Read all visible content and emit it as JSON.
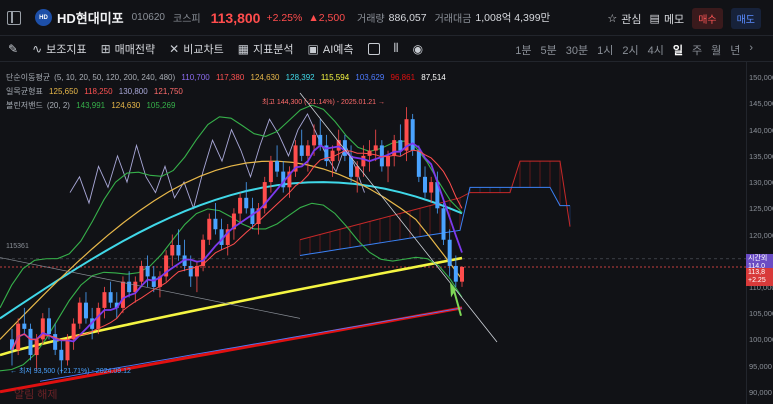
{
  "header": {
    "stock_name": "HD현대미포",
    "logo_text": "HD",
    "code": "010620",
    "market": "코스피",
    "price": "113,800",
    "change_pct": "+2.25%",
    "change_amt": "▲2,500",
    "volume_label": "거래량",
    "volume": "886,057",
    "amount_label": "거래대금",
    "amount": "1,008억 4,399만",
    "watchlist": "관심",
    "memo": "메모",
    "buy": "매수",
    "sell": "매도"
  },
  "toolbar": {
    "indicators": "보조지표",
    "strategy": "매매전략",
    "compare": "비교차트",
    "analysis": "지표분석",
    "ai": "AI예측",
    "periods": [
      "1분",
      "5분",
      "30분",
      "1시",
      "2시",
      "4시",
      "일",
      "주",
      "월",
      "년"
    ],
    "active_period": "일"
  },
  "legend": {
    "ma": {
      "label": "단순이동평균",
      "params": "(5, 10, 20, 50, 120, 200, 240, 480)",
      "values": [
        "110,700",
        "117,380",
        "124,630",
        "128,392",
        "115,594",
        "103,629",
        "96,861",
        "87,514"
      ]
    },
    "ichimoku": {
      "label": "일목균형표",
      "values": [
        "125,650",
        "118,250",
        "130,800",
        "121,750"
      ]
    },
    "bollinger": {
      "label": "볼린저밴드",
      "params": "(20, 2)",
      "values": [
        "143,991",
        "124,630",
        "105,269"
      ]
    }
  },
  "colors": {
    "up": "#ff4d4d",
    "down": "#4aa3ff",
    "ma5": "#7c3aed",
    "ma10": "#ff4d4d",
    "ma20": "#e8b84a",
    "ma50": "#40d8e8",
    "ma120": "#4d7bff",
    "ma200": "#ff6b6b",
    "ma240": "#ff9800",
    "ma480": "#ffffff",
    "ma_yellow": "#f5f542",
    "ma_red": "#e01010",
    "bb": "#36b04a",
    "cloud_red": "#c62828",
    "cloud_blue": "#3b82f6",
    "lagging": "#a9a8d8"
  },
  "annotations": {
    "high": "최고 144,300 (-21.14%) - 2025.01.21 →",
    "low": "← 최저 93,500 (+21.71%) - 2024.09.12",
    "level": "115361",
    "watermark": "알림 해제"
  },
  "axis": {
    "ticks": [
      "150,000",
      "145,000",
      "140,000",
      "135,000",
      "130,000",
      "125,000",
      "120,000",
      "115,000",
      "110,000",
      "105,000",
      "100,000",
      "95,000",
      "90,000"
    ],
    "tag_purple_top": "시간외",
    "tag_purple_bot": "114,0",
    "tag_red_top": "113,8",
    "tag_red_bot": "+2.25"
  },
  "chart_data": {
    "type": "candlestick",
    "y_range": [
      89000,
      151000
    ],
    "candles": [
      [
        100,
        102,
        95,
        98
      ],
      [
        98,
        104,
        97,
        103
      ],
      [
        103,
        106,
        101,
        102
      ],
      [
        102,
        103,
        96,
        97
      ],
      [
        97,
        101,
        94,
        100
      ],
      [
        100,
        105,
        99,
        104
      ],
      [
        104,
        106,
        100,
        101
      ],
      [
        101,
        103,
        97,
        98
      ],
      [
        98,
        100,
        93.5,
        96
      ],
      [
        96,
        101,
        95,
        100
      ],
      [
        100,
        104,
        98,
        103
      ],
      [
        103,
        108,
        102,
        107
      ],
      [
        107,
        109,
        103,
        104
      ],
      [
        104,
        106,
        100,
        102
      ],
      [
        102,
        107,
        101,
        106
      ],
      [
        106,
        110,
        104,
        109
      ],
      [
        109,
        111,
        106,
        107
      ],
      [
        107,
        109,
        104,
        106
      ],
      [
        106,
        112,
        105,
        111
      ],
      [
        111,
        113,
        108,
        109
      ],
      [
        109,
        112,
        107,
        111
      ],
      [
        111,
        115,
        110,
        114
      ],
      [
        114,
        116,
        110,
        112
      ],
      [
        112,
        114,
        109,
        110
      ],
      [
        110,
        113,
        108,
        112
      ],
      [
        112,
        117,
        111,
        116
      ],
      [
        116,
        120,
        114,
        118
      ],
      [
        118,
        121,
        115,
        116
      ],
      [
        116,
        119,
        113,
        114
      ],
      [
        114,
        116,
        110,
        112
      ],
      [
        112,
        115,
        109,
        114
      ],
      [
        114,
        120,
        113,
        119
      ],
      [
        119,
        124,
        118,
        123
      ],
      [
        123,
        126,
        120,
        121
      ],
      [
        121,
        123,
        117,
        118
      ],
      [
        118,
        122,
        116,
        121
      ],
      [
        121,
        125,
        119,
        124
      ],
      [
        124,
        128,
        122,
        127
      ],
      [
        127,
        130,
        124,
        125
      ],
      [
        125,
        127,
        121,
        122
      ],
      [
        122,
        126,
        120,
        125
      ],
      [
        125,
        131,
        124,
        130
      ],
      [
        130,
        135,
        128,
        134
      ],
      [
        134,
        137,
        131,
        132
      ],
      [
        132,
        134,
        128,
        129
      ],
      [
        129,
        133,
        127,
        132
      ],
      [
        132,
        138,
        131,
        137
      ],
      [
        137,
        140,
        134,
        135
      ],
      [
        135,
        138,
        132,
        137
      ],
      [
        137,
        141,
        135,
        139
      ],
      [
        139,
        142,
        136,
        137
      ],
      [
        137,
        139,
        133,
        134
      ],
      [
        134,
        137,
        131,
        136
      ],
      [
        136,
        140,
        134,
        138
      ],
      [
        138,
        139,
        134,
        135
      ],
      [
        135,
        137,
        130,
        131
      ],
      [
        131,
        134,
        128,
        133
      ],
      [
        133,
        137,
        131,
        135
      ],
      [
        135,
        138,
        132,
        136
      ],
      [
        136,
        140,
        134,
        137
      ],
      [
        137,
        138,
        132,
        133
      ],
      [
        133,
        136,
        130,
        135
      ],
      [
        135,
        139,
        133,
        138
      ],
      [
        138,
        141,
        135,
        136
      ],
      [
        136,
        144.3,
        134,
        142
      ],
      [
        142,
        143,
        135,
        136
      ],
      [
        136,
        137,
        130,
        131
      ],
      [
        131,
        133,
        127,
        128
      ],
      [
        128,
        131,
        126,
        130
      ],
      [
        130,
        132,
        124,
        125
      ],
      [
        125,
        126,
        118,
        119
      ],
      [
        119,
        121,
        112,
        114
      ],
      [
        114,
        116,
        110,
        111
      ],
      [
        111,
        114,
        110,
        113.8
      ]
    ]
  }
}
